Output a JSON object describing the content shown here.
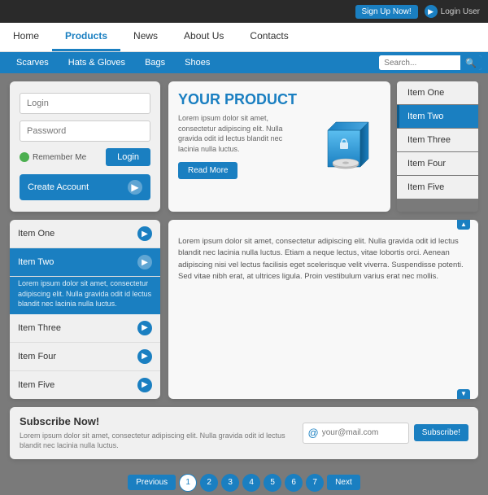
{
  "topbar": {
    "signup": "Sign Up Now!",
    "login": "Login User"
  },
  "nav": {
    "items": [
      "Home",
      "Products",
      "News",
      "About Us",
      "Contacts"
    ],
    "active": "Products"
  },
  "subnav": {
    "items": [
      "Scarves",
      "Hats & Gloves",
      "Bags",
      "Shoes"
    ],
    "search_placeholder": "Search..."
  },
  "login": {
    "login_placeholder": "Login",
    "password_placeholder": "Password",
    "remember_label": "Remember Me",
    "login_btn": "Login",
    "create_label": "Create Account"
  },
  "promo": {
    "title": "YOUR PRODUCT",
    "desc": "Lorem ipsum dolor sit amet, consectetur adipiscing elit. Nulla gravida odit id lectus blandit nec lacinia nulla luctus.",
    "btn": "Read More"
  },
  "items_right": {
    "items": [
      "Item One",
      "Item Two",
      "Item Three",
      "Item Four",
      "Item Five"
    ],
    "active": "Item Two"
  },
  "items_left": {
    "items": [
      {
        "label": "Item One"
      },
      {
        "label": "Item Two"
      },
      {
        "label": "Item Three"
      },
      {
        "label": "Item Four"
      },
      {
        "label": "Item Five"
      }
    ],
    "active": "Item Two",
    "active_content": "Lorem ipsum dolor sit amet, consectetur adipiscing elit. Nulla gravida odit id lectus blandit nec lacinia nulla luctus."
  },
  "content": {
    "text": "Lorem ipsum dolor sit amet, consectetur adipiscing elit. Nulla gravida odit id lectus blandit nec lacinia nulla luctus. Etiam a neque lectus, vitae lobortis orci. Aenean adipiscing nisi vel lectus facilisis eget scelerisque velit viverra. Suspendisse potenti. Sed vitae nibh erat, at ultrices ligula. Proin vestibulum varius erat nec mollis."
  },
  "subscribe": {
    "title": "Subscribe Now!",
    "desc": "Lorem ipsum dolor sit amet, consectetur adipiscing elit. Nulla gravida odit id lectus blandit nec lacinia nulla luctus.",
    "email_placeholder": "your@mail.com",
    "btn": "Subscribe!"
  },
  "pagination": {
    "prev": "Previous",
    "next": "Next",
    "pages": [
      "1",
      "2",
      "3",
      "4",
      "5",
      "6",
      "7"
    ],
    "active": "1"
  }
}
